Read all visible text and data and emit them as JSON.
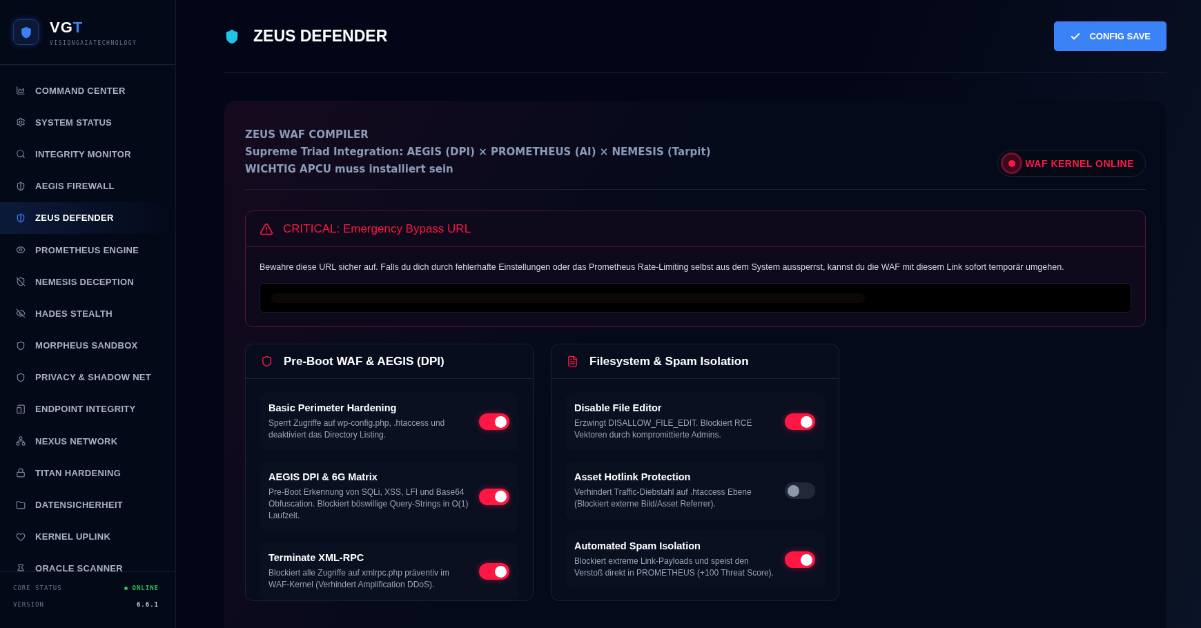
{
  "brand": {
    "name_main": "VG",
    "name_accent": "T",
    "tagline": "VISIONGAIATECHNOLOGY"
  },
  "sidebar": {
    "items": [
      {
        "label": "COMMAND CENTER",
        "selected": false
      },
      {
        "label": "SYSTEM STATUS",
        "selected": false
      },
      {
        "label": "INTEGRITY MONITOR",
        "selected": false
      },
      {
        "label": "AEGIS FIREWALL",
        "selected": false
      },
      {
        "label": "ZEUS DEFENDER",
        "selected": true
      },
      {
        "label": "PROMETHEUS ENGINE",
        "selected": false
      },
      {
        "label": "NEMESIS DECEPTION",
        "selected": false
      },
      {
        "label": "HADES STEALTH",
        "selected": false
      },
      {
        "label": "MORPHEUS SANDBOX",
        "selected": false
      },
      {
        "label": "PRIVACY & SHADOW NET",
        "selected": false
      },
      {
        "label": "ENDPOINT INTEGRITY",
        "selected": false
      },
      {
        "label": "NEXUS NETWORK",
        "selected": false
      },
      {
        "label": "TITAN HARDENING",
        "selected": false
      },
      {
        "label": "DATENSICHERHEIT",
        "selected": false
      },
      {
        "label": "KERNEL UPLINK",
        "selected": false
      },
      {
        "label": "ORACLE SCANNER",
        "selected": false
      }
    ],
    "footer": [
      {
        "label": "CORE STATUS",
        "value": "ONLINE",
        "kind": "status"
      },
      {
        "label": "VERSION",
        "value": "6.6.1",
        "kind": "plain"
      }
    ]
  },
  "header": {
    "title": "ZEUS DEFENDER",
    "save_button": "CONFIG SAVE"
  },
  "compiler": {
    "lines": [
      "ZEUS WAF COMPILER",
      "Supreme Triad Integration: AEGIS (DPI) × PROMETHEUS (AI) × NEMESIS (Tarpit)",
      "WICHTIG APCU muss installiert sein"
    ],
    "status_badge": "WAF KERNEL ONLINE"
  },
  "critical": {
    "title": "CRITICAL: Emergency Bypass URL",
    "text": "Bewahre diese URL sicher auf. Falls du dich durch fehlerhafte Einstellungen oder das Prometheus Rate-Limiting selbst aus dem System aussperrst, kannst du die WAF mit diesem Link sofort temporär umgehen."
  },
  "cards": [
    {
      "title": "Pre-Boot WAF & AEGIS (DPI)",
      "kind": "shield",
      "options": [
        {
          "title": "Basic Perimeter Hardening",
          "description": "Sperrt Zugriffe auf wp-config.php, .htaccess und deaktiviert das Directory Listing.",
          "on": true
        },
        {
          "title": "AEGIS DPI & 6G Matrix",
          "description": "Pre-Boot Erkennung von SQLi, XSS, LFI und Base64 Obfuscation. Blockiert böswillige Query-Strings in O(1) Laufzeit.",
          "on": true
        },
        {
          "title": "Terminate XML-RPC",
          "description": "Blockiert alle Zugriffe auf xmlrpc.php präventiv im WAF-Kernel (Verhindert Amplification DDoS).",
          "on": true
        }
      ]
    },
    {
      "title": "Filesystem & Spam Isolation",
      "kind": "file",
      "options": [
        {
          "title": "Disable File Editor",
          "description": "Erzwingt DISALLOW_FILE_EDIT. Blockiert RCE Vektoren durch kompromittierte Admins.",
          "on": true
        },
        {
          "title": "Asset Hotlink Protection",
          "description": "Verhindert Traffic-Diebstahl auf .htaccess Ebene (Blockiert externe Bild/Asset Referrer).",
          "on": false
        },
        {
          "title": "Automated Spam Isolation",
          "description": "Blockiert extreme Link-Payloads und speist den Verstoß direkt in PROMETHEUS (+100 Threat Score).",
          "on": true
        }
      ]
    }
  ]
}
